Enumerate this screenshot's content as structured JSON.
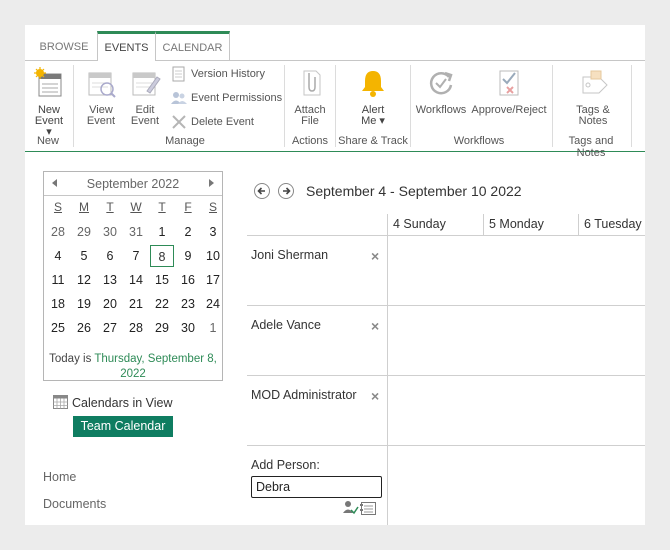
{
  "ribbon": {
    "tabs": [
      {
        "label": "BROWSE"
      },
      {
        "label": "EVENTS"
      },
      {
        "label": "CALENDAR"
      }
    ],
    "new_event": "New\nEvent ▾",
    "view_event": "View\nEvent",
    "edit_event": "Edit\nEvent",
    "version_history": "Version History",
    "event_permissions": "Event Permissions",
    "delete_event": "Delete Event",
    "attach_file": "Attach\nFile",
    "alert_me": "Alert\nMe ▾",
    "workflows": "Workflows",
    "approve_reject": "Approve/Reject",
    "tags_notes": "Tags &\nNotes",
    "groups": {
      "new": "New",
      "manage": "Manage",
      "actions": "Actions",
      "share_track": "Share & Track",
      "workflows": "Workflows",
      "tags_notes": "Tags and Notes"
    },
    "colors": {
      "accent": "#2e8b57",
      "alert": "#f4b400"
    }
  },
  "date_picker": {
    "title": "September 2022",
    "weekdays": [
      "S",
      "M",
      "T",
      "W",
      "T",
      "F",
      "S"
    ],
    "weeks": [
      [
        {
          "d": "28",
          "muted": true
        },
        {
          "d": "29",
          "muted": true
        },
        {
          "d": "30",
          "muted": true
        },
        {
          "d": "31",
          "muted": true
        },
        {
          "d": "1"
        },
        {
          "d": "2"
        },
        {
          "d": "3"
        }
      ],
      [
        {
          "d": "4"
        },
        {
          "d": "5"
        },
        {
          "d": "6"
        },
        {
          "d": "7"
        },
        {
          "d": "8",
          "selected": true
        },
        {
          "d": "9"
        },
        {
          "d": "10"
        }
      ],
      [
        {
          "d": "11"
        },
        {
          "d": "12"
        },
        {
          "d": "13"
        },
        {
          "d": "14"
        },
        {
          "d": "15"
        },
        {
          "d": "16"
        },
        {
          "d": "17"
        }
      ],
      [
        {
          "d": "18"
        },
        {
          "d": "19"
        },
        {
          "d": "20"
        },
        {
          "d": "21"
        },
        {
          "d": "22"
        },
        {
          "d": "23"
        },
        {
          "d": "24"
        }
      ],
      [
        {
          "d": "25"
        },
        {
          "d": "26"
        },
        {
          "d": "27"
        },
        {
          "d": "28"
        },
        {
          "d": "29"
        },
        {
          "d": "30"
        },
        {
          "d": "1",
          "muted": true
        }
      ]
    ],
    "today_prefix": "Today is ",
    "today_date": "Thursday, September 8, 2022"
  },
  "calendars_in_view": {
    "label": "Calendars in View",
    "items": [
      "Team Calendar"
    ],
    "color": "#0f7d61"
  },
  "quick_launch": [
    "Home",
    "Documents"
  ],
  "scheduler": {
    "range": "September 4 - September 10 2022",
    "days": [
      "4 Sunday",
      "5 Monday",
      "6 Tuesday"
    ],
    "people": [
      "Joni Sherman",
      "Adele Vance",
      "MOD Administrator"
    ],
    "remove_glyph": "×",
    "add_person_label": "Add Person:",
    "add_person_value": "Debra"
  }
}
